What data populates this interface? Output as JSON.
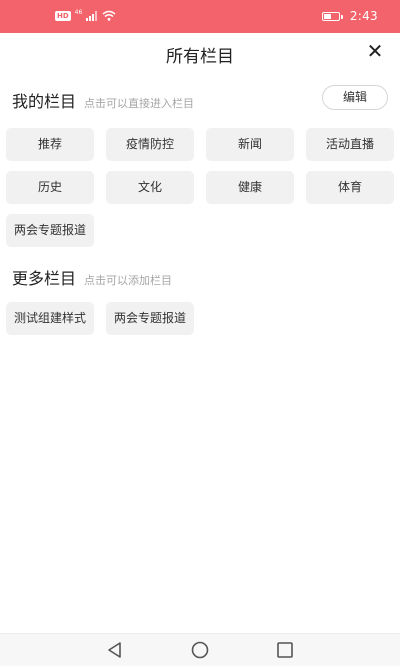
{
  "status_bar": {
    "hd_badge": "HD",
    "network": "46",
    "time": "2:43",
    "battery_level": 0.55
  },
  "header": {
    "title": "所有栏目",
    "close_symbol": "✕"
  },
  "my_channels": {
    "title": "我的栏目",
    "hint": "点击可以直接进入栏目",
    "edit_label": "编辑",
    "items": [
      "推荐",
      "疫情防控",
      "新闻",
      "活动直播",
      "历史",
      "文化",
      "健康",
      "体育",
      "两会专题报道"
    ]
  },
  "more_channels": {
    "title": "更多栏目",
    "hint": "点击可以添加栏目",
    "items": [
      "测试组建样式",
      "两会专题报道"
    ]
  },
  "nav_bar": {
    "icons": [
      "back-icon",
      "home-icon",
      "recents-icon"
    ]
  },
  "colors": {
    "status_bar_bg": "#f2636b",
    "chip_bg": "#f1f1f1",
    "hint_text": "#a6a6a6"
  }
}
